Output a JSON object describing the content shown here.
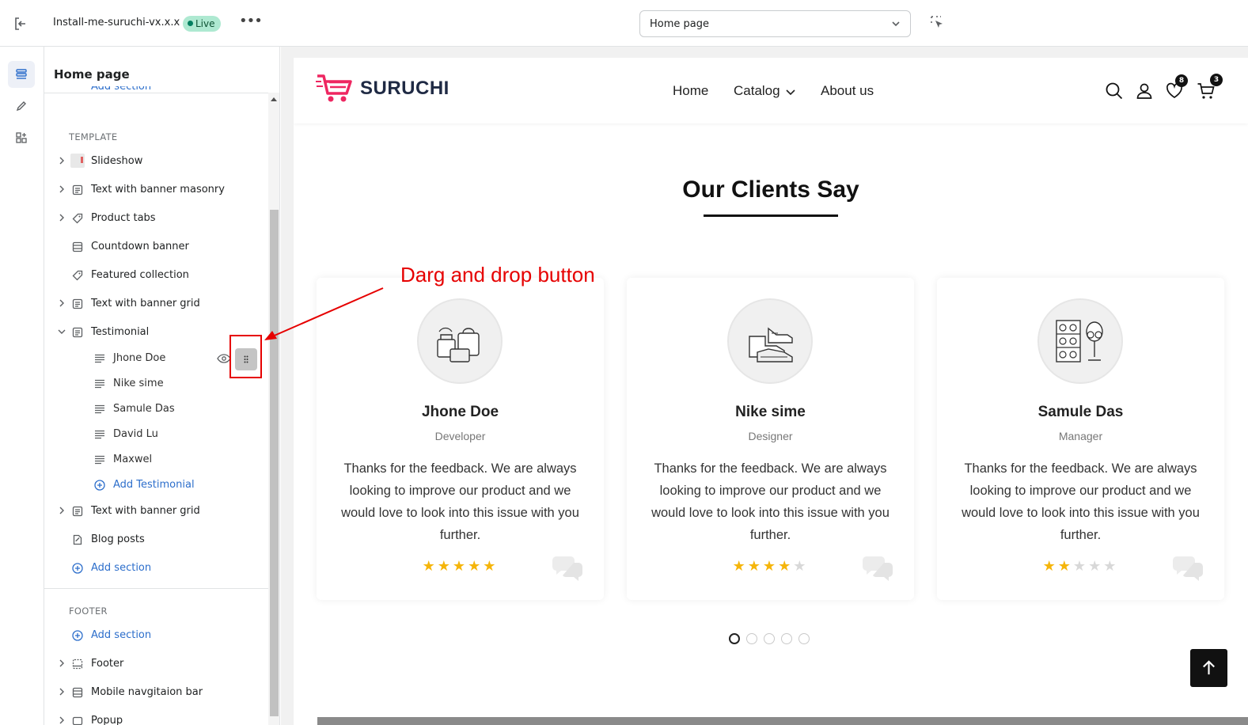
{
  "topbar": {
    "theme_name": "Install-me-suruchi-vx.x.x",
    "live_label": "Live",
    "more_label": "•••",
    "page_select": {
      "value": "Home page"
    }
  },
  "sidebar": {
    "title": "Home page",
    "clipped_add_label": "Add section",
    "template_label": "TEMPLATE",
    "template_sections": [
      {
        "label": "Slideshow",
        "icon": "image-thumbnail",
        "expandable": true
      },
      {
        "label": "Text with banner masonry",
        "icon": "section-icon",
        "expandable": true
      },
      {
        "label": "Product tabs",
        "icon": "tag-icon",
        "expandable": true
      },
      {
        "label": "Countdown banner",
        "icon": "countdown-icon",
        "expandable": false
      },
      {
        "label": "Featured collection",
        "icon": "tag-icon",
        "expandable": false
      },
      {
        "label": "Text with banner grid",
        "icon": "section-icon",
        "expandable": true
      },
      {
        "label": "Testimonial",
        "icon": "section-icon",
        "expandable": true,
        "expanded": true
      }
    ],
    "testimonial_blocks": [
      {
        "label": "Jhone Doe"
      },
      {
        "label": "Nike sime"
      },
      {
        "label": "Samule Das"
      },
      {
        "label": "David Lu"
      },
      {
        "label": "Maxwel"
      }
    ],
    "add_testimonial_label": "Add Testimonial",
    "after_sections": [
      {
        "label": "Text with banner grid",
        "icon": "section-icon",
        "expandable": true
      },
      {
        "label": "Blog posts",
        "icon": "blog-icon",
        "expandable": false
      }
    ],
    "add_section_label": "Add section",
    "footer_label": "FOOTER",
    "footer_add_section_label": "Add section",
    "footer_sections": [
      {
        "label": "Footer",
        "icon": "footer-icon",
        "expandable": true
      },
      {
        "label": "Mobile navgitaion bar",
        "icon": "countdown-icon",
        "expandable": true
      },
      {
        "label": "Popup",
        "icon": "popup-icon",
        "expandable": true
      }
    ]
  },
  "store": {
    "brand": "SURUCHI",
    "nav": {
      "home": "Home",
      "catalog": "Catalog",
      "about": "About us"
    },
    "wishlist_count": "8",
    "cart_count": "3",
    "accent": "#ee2761"
  },
  "testimonials": {
    "title": "Our Clients Say",
    "cards": [
      {
        "name": "Jhone Doe",
        "role": "Developer",
        "text": "Thanks for the feedback. We are always looking to improve our product and we would love to look into this issue with you further.",
        "rating": 5
      },
      {
        "name": "Nike sime",
        "role": "Designer",
        "text": "Thanks for the feedback. We are always looking to improve our product and we would love to look into this issue with you further.",
        "rating": 4
      },
      {
        "name": "Samule Das",
        "role": "Manager",
        "text": "Thanks for the feedback. We are always looking to improve our product and we would love to look into this issue with you further.",
        "rating": 2
      }
    ],
    "pagination_count": 5,
    "active_page": 1
  },
  "annotation": {
    "text": "Darg and drop button",
    "color": "#e60000"
  }
}
